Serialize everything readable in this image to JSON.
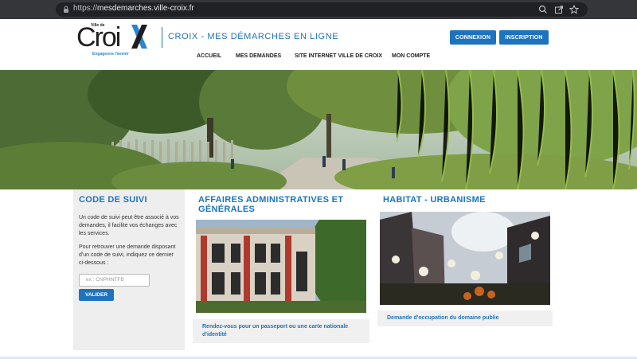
{
  "browser": {
    "url_scheme": "https://",
    "url_host": "mesdemarches.ville-croix.fr",
    "icons": [
      "lock-icon",
      "zoom-icon",
      "share-icon",
      "bookmark-star-icon"
    ]
  },
  "header": {
    "logo": {
      "small": "Ville de",
      "name": "Croi",
      "tagline": "Engageons l'avenir"
    },
    "site_title": "CROIX - MES DÉMARCHES EN LIGNE",
    "login_label": "CONNEXION",
    "register_label": "INSCRIPTION",
    "nav": [
      "ACCUEIL",
      "MES DEMANDES",
      "SITE INTERNET VILLE DE CROIX",
      "MON COMPTE"
    ]
  },
  "tracking": {
    "title": "CODE DE SUIVI",
    "text1": "Un code de suivi peut être associé à vos demandes, il facilite vos échanges avec les services.",
    "text2": "Pour retrouver une demande disposant d'un code de suivi, indiquez ce dernier ci-dessous :",
    "placeholder": "ex : CNPHNTFB",
    "button": "VALIDER"
  },
  "categories": [
    {
      "title": "AFFAIRES ADMINISTRATIVES ET GÉNÉRALES",
      "link": "Rendez-vous pour un passeport ou une carte nationale d'identité"
    },
    {
      "title": "HABITAT - URBANISME",
      "link": "Demande d'occupation du domaine public"
    }
  ],
  "colors": {
    "accent": "#1e73be",
    "chrome": "#35363a",
    "panel": "#eeeeee"
  }
}
